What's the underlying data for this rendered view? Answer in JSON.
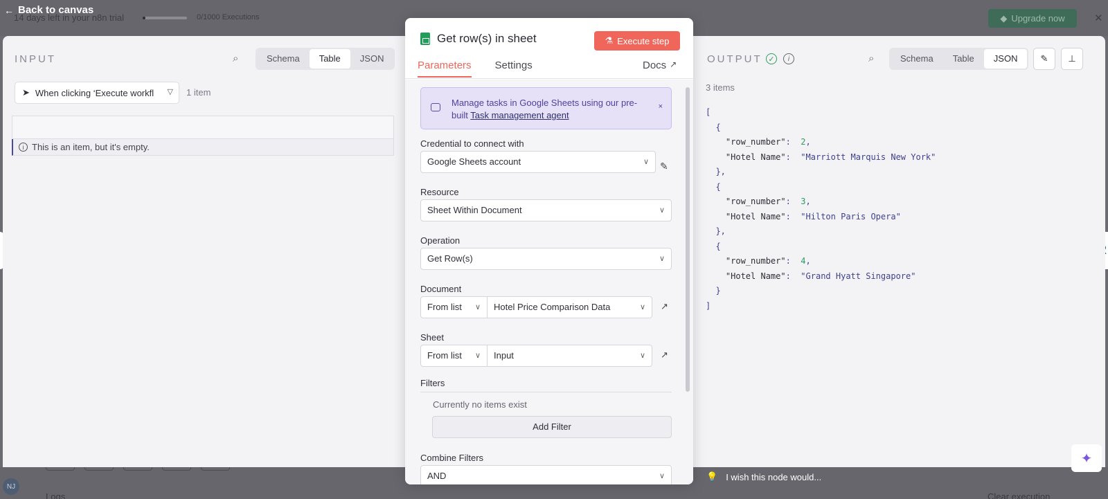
{
  "topbar": {
    "back_label": "Back to canvas",
    "trial_text": "14 days left in your n8n trial",
    "executions": "0/1000 Executions",
    "executions_used_fraction": 0.0,
    "upgrade_label": "Upgrade now"
  },
  "input": {
    "title": "INPUT",
    "view_tabs": [
      "Schema",
      "Table",
      "JSON"
    ],
    "active_tab": "Table",
    "trigger_select": "When clicking ‘Execute workfl",
    "item_count": "1 item",
    "empty_message": "This is an item, but it's empty."
  },
  "node": {
    "title": "Get row(s) in sheet",
    "execute_label": "Execute step",
    "tabs": [
      "Parameters",
      "Settings"
    ],
    "active_tab": "Parameters",
    "docs_label": "Docs",
    "banner": {
      "text_prefix": "Manage tasks in Google Sheets using our pre-built ",
      "link": "Task management agent",
      "close": "×"
    },
    "credential": {
      "label": "Credential to connect with",
      "value": "Google Sheets account"
    },
    "resource": {
      "label": "Resource",
      "value": "Sheet Within Document"
    },
    "operation": {
      "label": "Operation",
      "value": "Get Row(s)"
    },
    "document": {
      "label": "Document",
      "mode": "From list",
      "value": "Hotel Price Comparison Data"
    },
    "sheet": {
      "label": "Sheet",
      "mode": "From list",
      "value": "Input"
    },
    "filters": {
      "label": "Filters",
      "empty": "Currently no items exist",
      "add_label": "Add Filter"
    },
    "combine": {
      "label": "Combine Filters",
      "value": "AND"
    }
  },
  "output": {
    "title": "OUTPUT",
    "view_tabs": [
      "Schema",
      "Table",
      "JSON"
    ],
    "active_tab": "JSON",
    "item_count": "3 items",
    "rows": [
      {
        "row_number": "2",
        "hotel": "\"Marriott Marquis New York\""
      },
      {
        "row_number": "3",
        "hotel": "\"Hilton Paris Opera\""
      },
      {
        "row_number": "4",
        "hotel": "\"Grand Hyatt Singapore\""
      }
    ],
    "key_row_number": "\"row_number\"",
    "key_hotel": "\"Hotel Name\"",
    "wish_text": "I wish this node would..."
  },
  "canvas": {
    "logs_label": "Logs",
    "clear_label": "Clear execution",
    "avatar_initials": "NJ"
  },
  "colors": {
    "accent": "#f0665a",
    "upgrade": "#3f6b59",
    "success": "#2f9e5c",
    "banner_bg": "#e6e1f6"
  }
}
